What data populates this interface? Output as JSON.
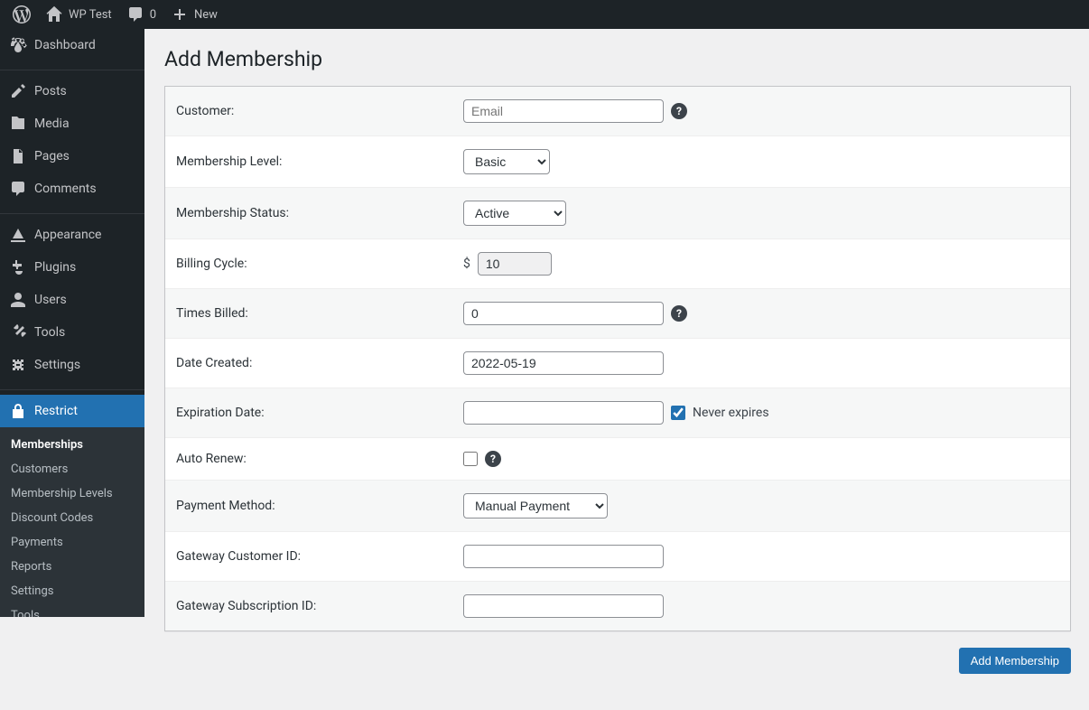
{
  "adminbar": {
    "site_name": "WP Test",
    "comments_count": "0",
    "new_label": "New"
  },
  "sidebar": {
    "dashboard": "Dashboard",
    "posts": "Posts",
    "media": "Media",
    "pages": "Pages",
    "comments": "Comments",
    "appearance": "Appearance",
    "plugins": "Plugins",
    "users": "Users",
    "tools": "Tools",
    "settings": "Settings",
    "restrict": "Restrict",
    "submenu": {
      "memberships": "Memberships",
      "customers": "Customers",
      "levels": "Membership Levels",
      "discounts": "Discount Codes",
      "payments": "Payments",
      "reports": "Reports",
      "settings": "Settings",
      "tools": "Tools"
    }
  },
  "page": {
    "title": "Add Membership",
    "submit_label": "Add Membership"
  },
  "form": {
    "customer": {
      "label": "Customer:",
      "placeholder": "Email",
      "value": ""
    },
    "level": {
      "label": "Membership Level:",
      "value": "Basic",
      "options": [
        "Basic"
      ]
    },
    "status": {
      "label": "Membership Status:",
      "value": "Active",
      "options": [
        "Active"
      ]
    },
    "billing_cycle": {
      "label": "Billing Cycle:",
      "currency": "$",
      "value": "10"
    },
    "times_billed": {
      "label": "Times Billed:",
      "value": "0"
    },
    "date_created": {
      "label": "Date Created:",
      "value": "2022-05-19"
    },
    "expiration": {
      "label": "Expiration Date:",
      "value": "",
      "never_label": "Never expires",
      "never_checked": true
    },
    "auto_renew": {
      "label": "Auto Renew:",
      "checked": false
    },
    "payment_method": {
      "label": "Payment Method:",
      "value": "Manual Payment",
      "options": [
        "Manual Payment"
      ]
    },
    "gateway_customer": {
      "label": "Gateway Customer ID:",
      "value": ""
    },
    "gateway_subscription": {
      "label": "Gateway Subscription ID:",
      "value": ""
    }
  }
}
